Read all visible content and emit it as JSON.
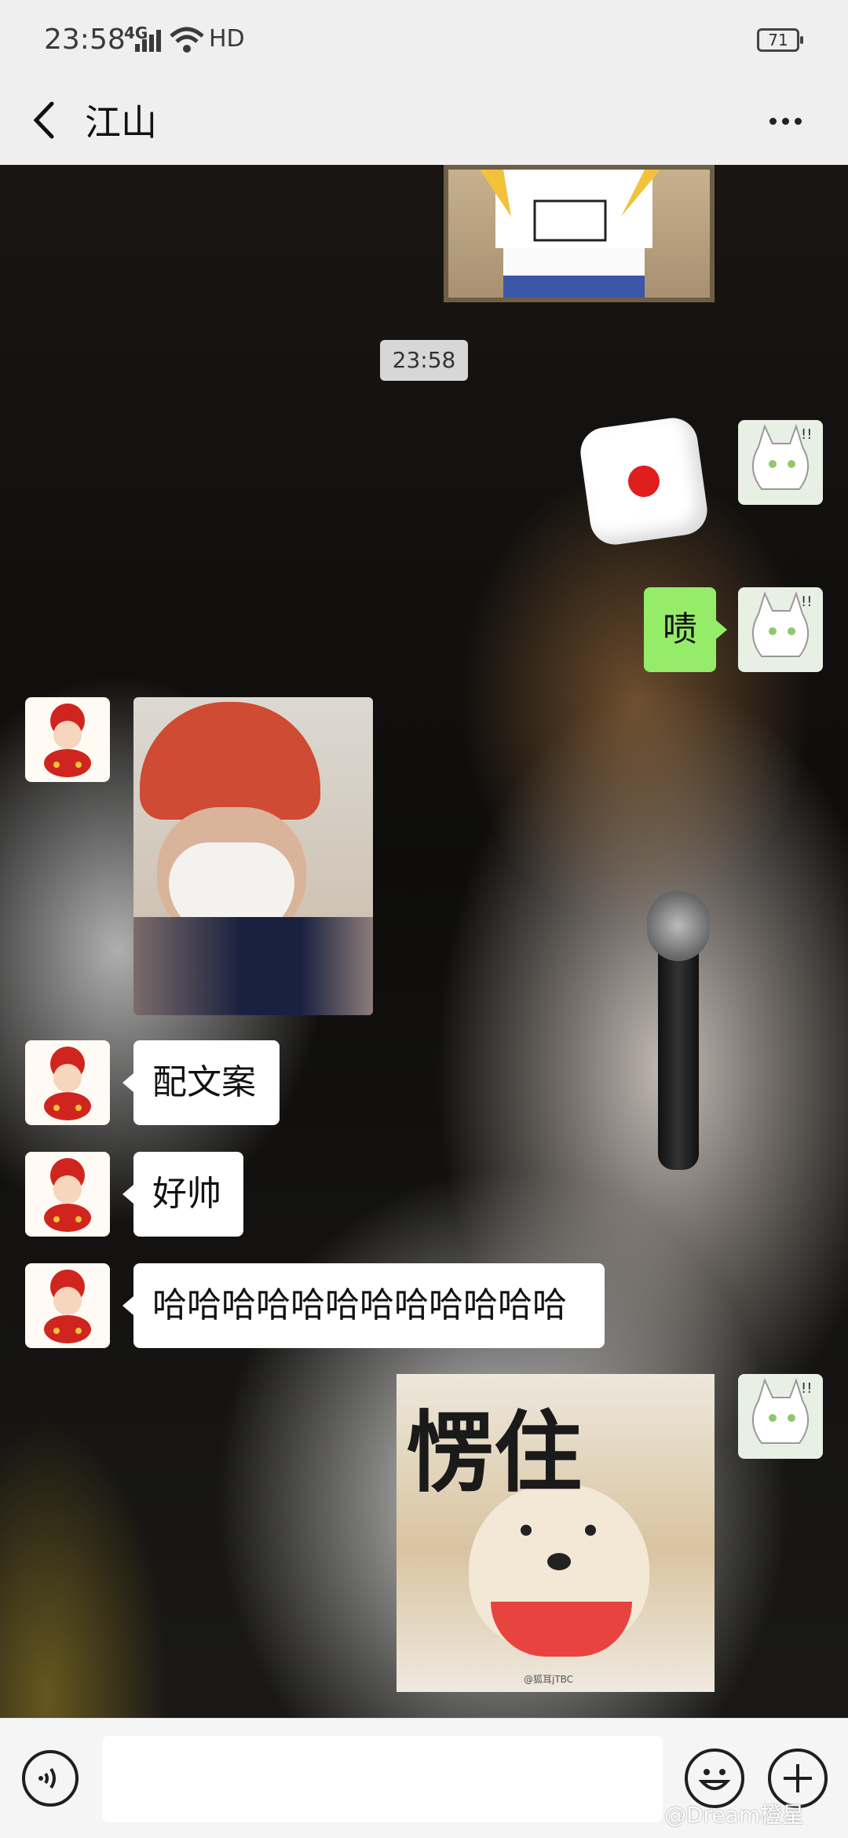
{
  "status_bar": {
    "time": "23:58",
    "network": "4G",
    "signal": "HD",
    "battery": "71"
  },
  "header": {
    "title": "江山"
  },
  "chat": {
    "timestamp": "23:58",
    "messages": [
      {
        "sender": "self",
        "type": "sticker"
      },
      {
        "sender": "self",
        "type": "dice",
        "face": 1
      },
      {
        "sender": "self",
        "type": "text",
        "text": "啧"
      },
      {
        "sender": "other",
        "type": "photo"
      },
      {
        "sender": "other",
        "type": "text",
        "text": "配文案"
      },
      {
        "sender": "other",
        "type": "text",
        "text": "好帅"
      },
      {
        "sender": "other",
        "type": "text",
        "text": "哈哈哈哈哈哈哈哈哈哈哈哈"
      },
      {
        "sender": "self",
        "type": "sticker",
        "text": "愣住",
        "watermark": "@狐耳jTBC"
      }
    ]
  },
  "footer": {
    "watermark": "@Dream橙星"
  }
}
